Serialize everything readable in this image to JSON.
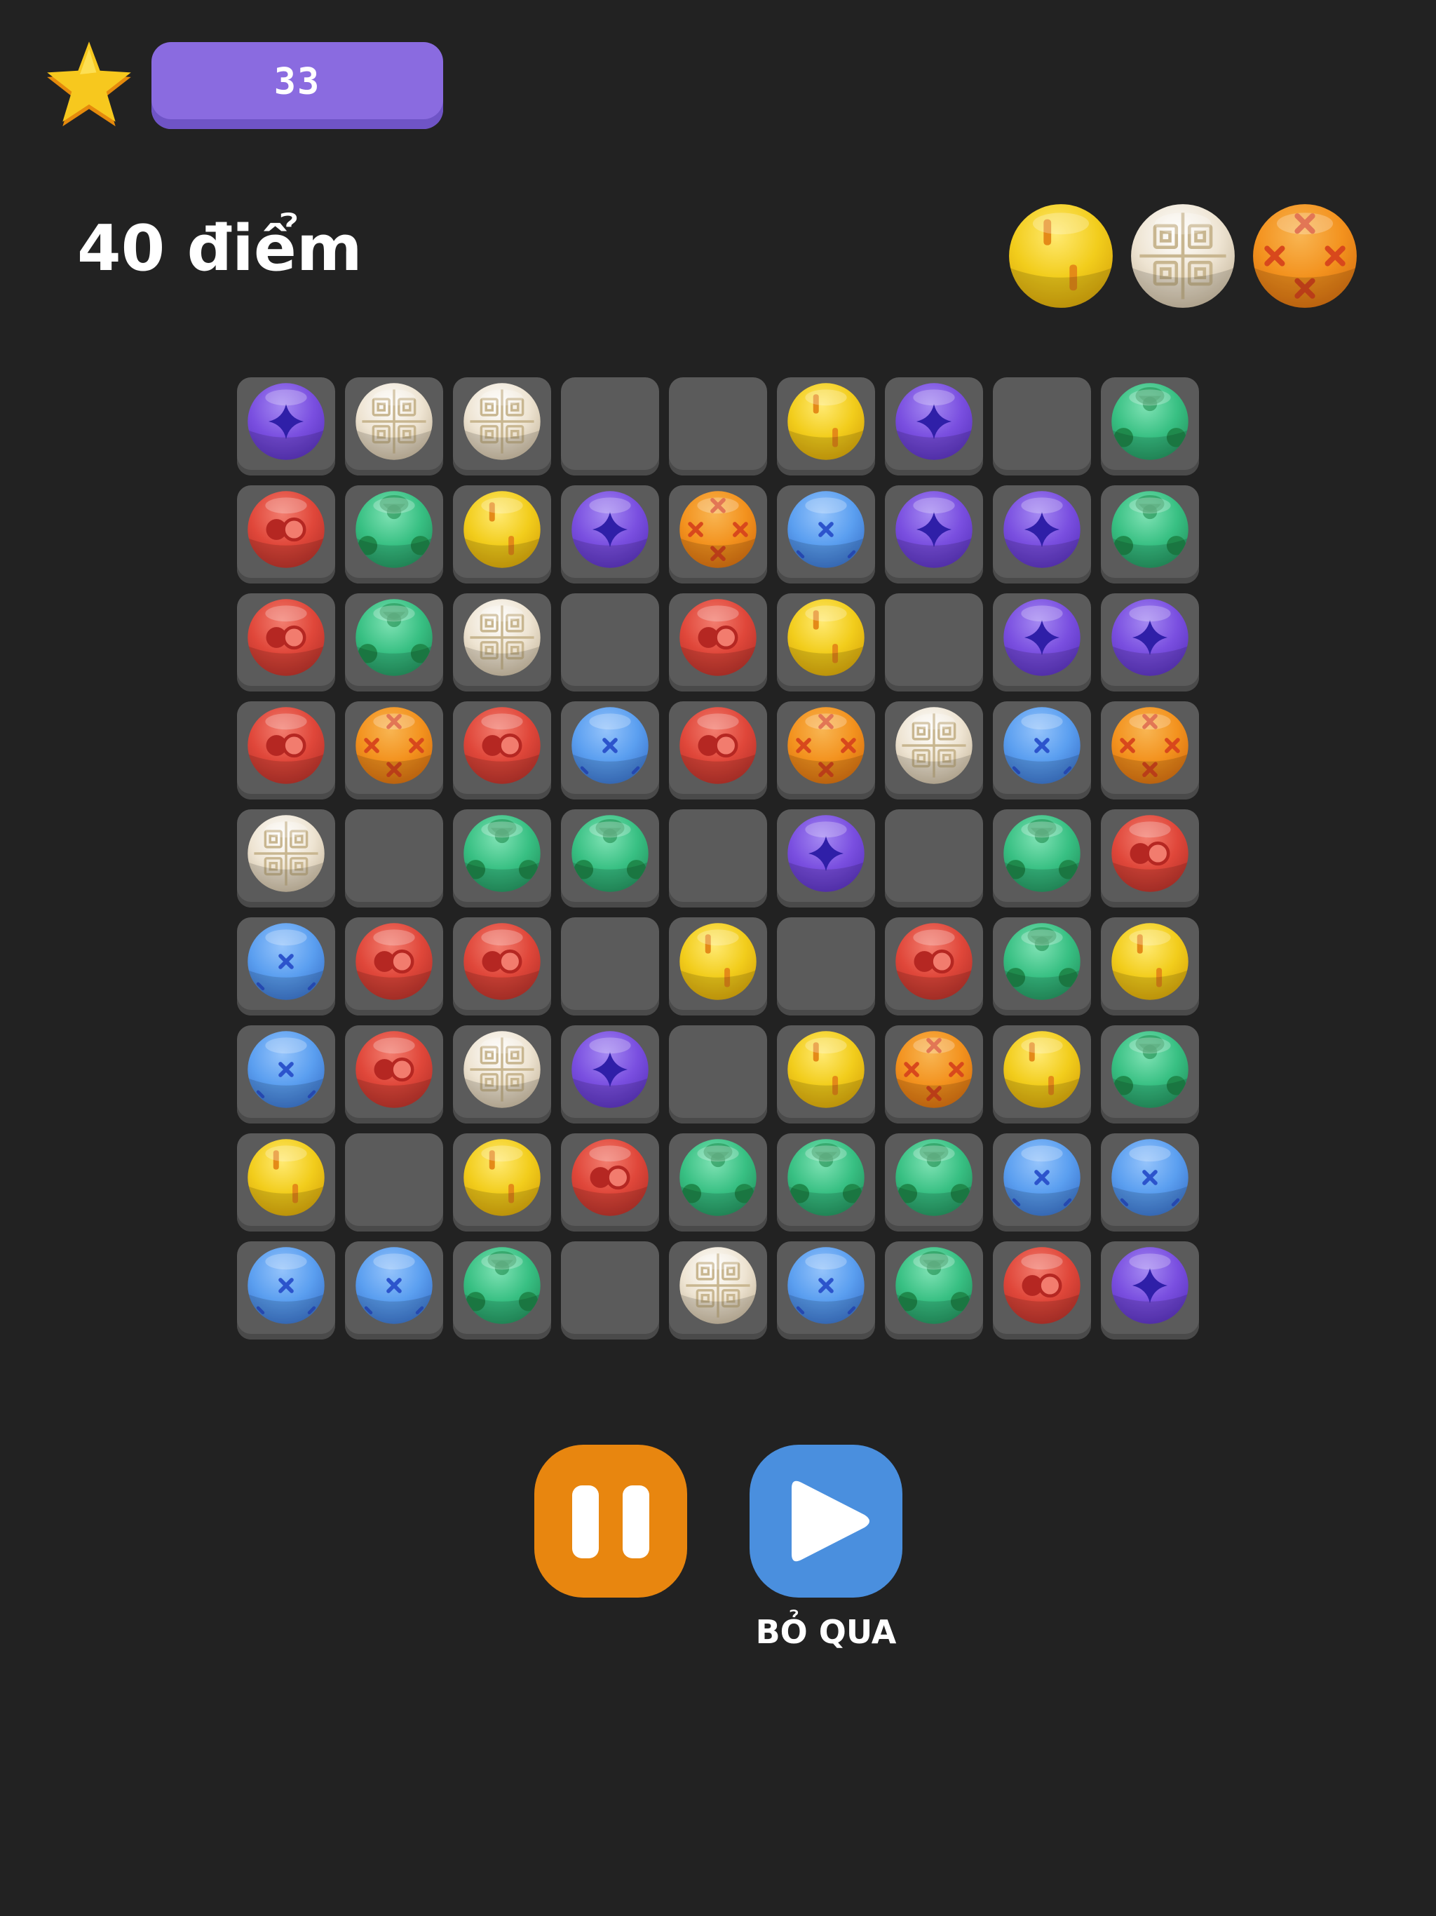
{
  "level": "33",
  "score_text": "40 điểm",
  "next_balls": [
    "yellow",
    "cream",
    "orange"
  ],
  "board": {
    "rows": [
      [
        "purple",
        "cream",
        "cream",
        null,
        null,
        "yellow",
        "purple",
        null,
        "green"
      ],
      [
        "red",
        "green",
        "yellow",
        "purple",
        "orange",
        "blue",
        "purple",
        "purple",
        "green"
      ],
      [
        "red",
        "green",
        "cream",
        null,
        "red",
        "yellow",
        null,
        "purple",
        "purple"
      ],
      [
        "red",
        "orange",
        "red",
        "blue",
        "red",
        "orange",
        "cream",
        "blue",
        "orange"
      ],
      [
        "cream",
        null,
        "green",
        "green",
        null,
        "purple",
        null,
        "green",
        "red"
      ],
      [
        "blue",
        "red",
        "red",
        null,
        "yellow",
        null,
        "red",
        "green",
        "yellow"
      ],
      [
        "blue",
        "red",
        "cream",
        "purple",
        null,
        "yellow",
        "orange",
        "yellow",
        "green"
      ],
      [
        "yellow",
        null,
        "yellow",
        "red",
        "green",
        "green",
        "green",
        "blue",
        "blue"
      ],
      [
        "blue",
        "blue",
        "green",
        null,
        "cream",
        "blue",
        "green",
        "red",
        "purple"
      ]
    ]
  },
  "buttons": {
    "pause_icon": "pause-icon",
    "skip_icon": "play-icon",
    "skip_label": "BỎ QUA"
  },
  "colors": {
    "background": "#222222",
    "level_pill": "#8a6be0",
    "pause_button": "#e8860f",
    "skip_button": "#4a8fde",
    "cell": "#5b5b5b"
  }
}
